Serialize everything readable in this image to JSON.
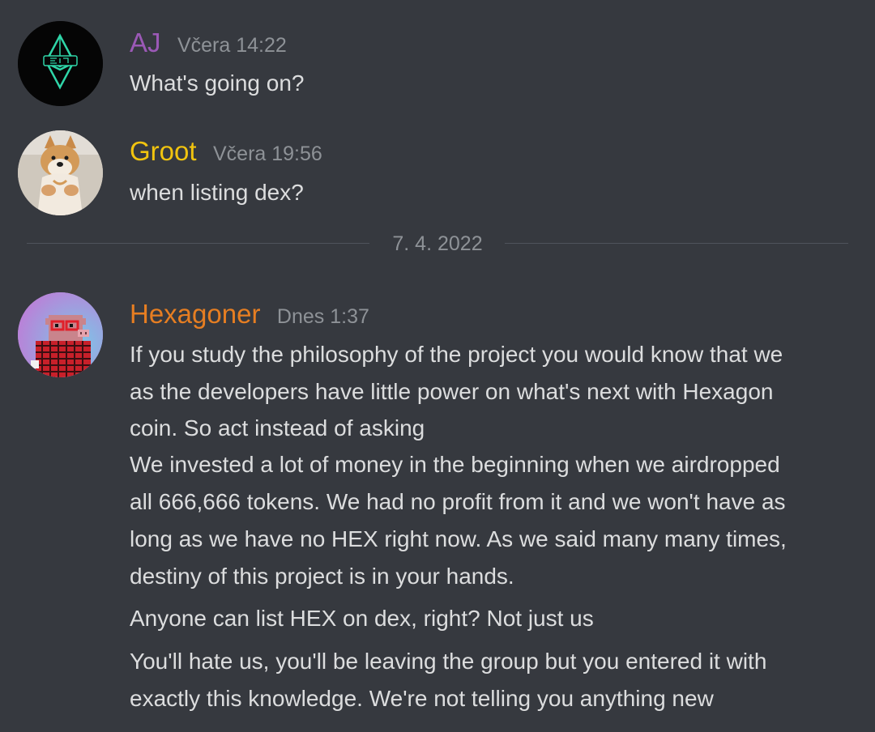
{
  "messages": [
    {
      "username": "AJ",
      "username_color": "#9b59b6",
      "timestamp": "Včera 14:22",
      "avatar_icon": "ethereum-logo-icon",
      "avatar_bg": "#050505",
      "lines": [
        "What's going on?"
      ]
    },
    {
      "username": "Groot",
      "username_color": "#f1c40f",
      "timestamp": "Včera 19:56",
      "avatar_icon": "shiba-dog-avatar-icon",
      "avatar_bg": "#cfc8bd",
      "lines": [
        "when listing dex?"
      ]
    },
    {
      "username": "Hexagoner",
      "username_color": "#e67e22",
      "timestamp": "Dnes 1:37",
      "avatar_icon": "pixel-pig-avatar-icon",
      "avatar_bg": "#b48ad8",
      "lines": [
        "If you study  the philosophy of the project you would know that we",
        "as the developers have little power on what's next with Hexagon",
        "coin. So act instead of asking",
        "We invested a lot of money in the beginning when we airdropped",
        "all 666,666 tokens. We had no profit from it and we won't have as",
        "long as we have no HEX right now. As we said many many times,",
        "destiny of this project is in your hands.",
        "Anyone can list HEX on dex, right? Not just us",
        "You'll hate us, you'll be leaving the group but you entered it with",
        "exactly this knowledge. We're not telling you anything new"
      ]
    }
  ],
  "date_divider": "7. 4. 2022",
  "colors": {
    "background": "#36393f",
    "text": "#dcddde",
    "muted": "#8e9297",
    "divider": "#4f545c"
  }
}
